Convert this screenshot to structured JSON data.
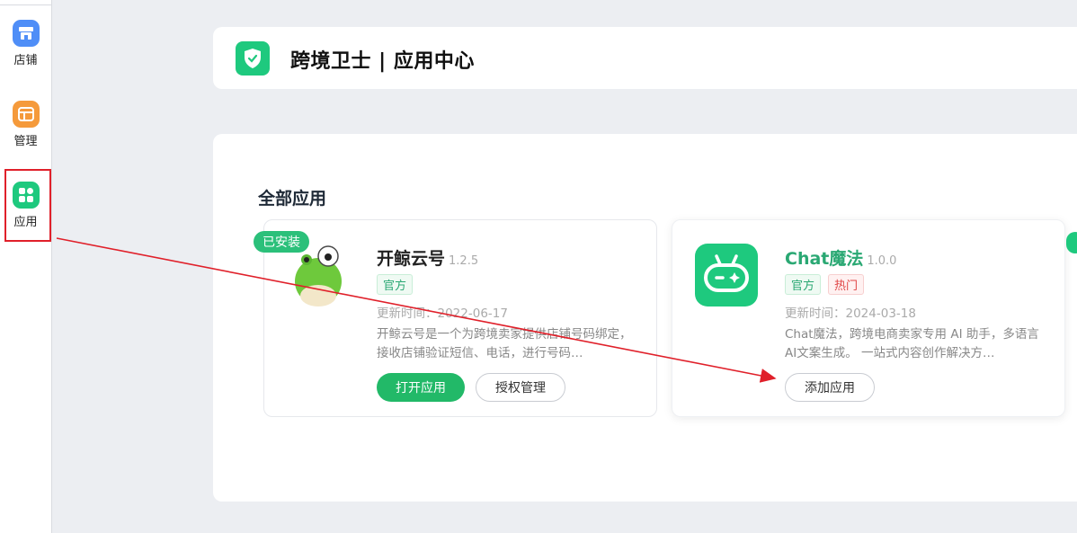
{
  "sidebar": {
    "items": [
      {
        "label": "店铺",
        "icon": "store-icon",
        "color": "#4f8ef7"
      },
      {
        "label": "管理",
        "icon": "manage-icon",
        "color": "#f59a3b"
      },
      {
        "label": "应用",
        "icon": "apps-grid-icon",
        "color": "#1ec97e"
      }
    ]
  },
  "header": {
    "title": "跨境卫士 | 应用中心",
    "logo_icon": "shield-icon"
  },
  "main": {
    "section_title": "全部应用",
    "apps": [
      {
        "badge": "已安装",
        "name": "开鲸云号",
        "version": "1.2.5",
        "tags": [
          "官方"
        ],
        "updated": "更新时间：2022-06-17",
        "description": "开鲸云号是一个为跨境卖家提供店铺号码绑定，接收店铺验证短信、电话，进行号码…",
        "buttons": [
          "打开应用",
          "授权管理"
        ],
        "icon": "frog-icon"
      },
      {
        "name": "Chat魔法",
        "version": "1.0.0",
        "tags": [
          "官方",
          "热门"
        ],
        "updated": "更新时间：2024-03-18",
        "description": "Chat魔法，跨境电商卖家专用 AI 助手，多语言AI文案生成。 一站式内容创作解决方…",
        "buttons": [
          "添加应用"
        ],
        "icon": "robot-icon"
      }
    ]
  },
  "colors": {
    "accent": "#1ec97e",
    "annotation": "#e0202a"
  }
}
